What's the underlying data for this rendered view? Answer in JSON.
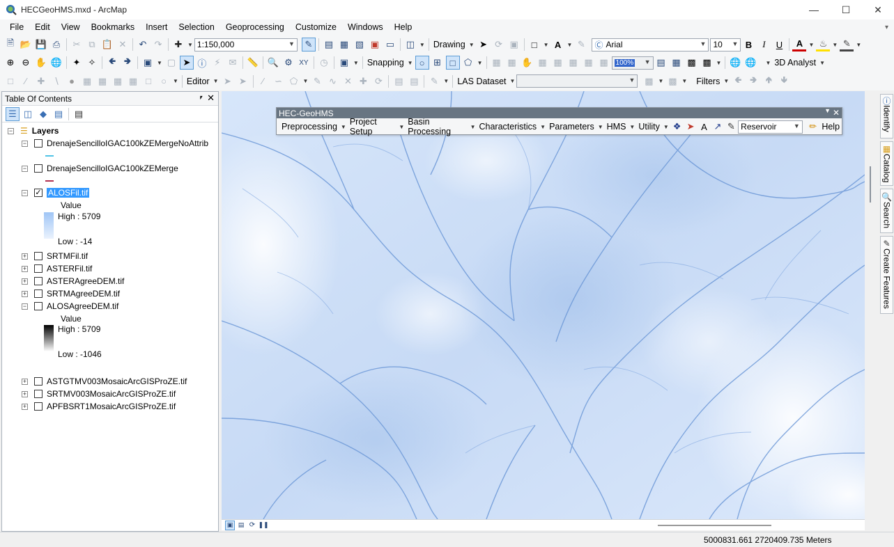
{
  "window": {
    "title": "HECGeoHMS.mxd - ArcMap",
    "min": "—",
    "max": "☐",
    "close": "✕"
  },
  "menu": [
    "File",
    "Edit",
    "View",
    "Bookmarks",
    "Insert",
    "Selection",
    "Geoprocessing",
    "Customize",
    "Windows",
    "Help"
  ],
  "toolbar": {
    "scale": "1:150,000",
    "drawing_label": "Drawing",
    "font_name": "Arial",
    "font_size": "10",
    "bold": "B",
    "italic": "I",
    "underline": "U",
    "text_a": "A",
    "snapping_label": "Snapping",
    "analyst_label": "3D Analyst",
    "editor_label": "Editor",
    "las_label": "LAS Dataset",
    "filters_label": "Filters"
  },
  "toc": {
    "title": "Table Of Contents",
    "pin": "⬍",
    "close": "✕",
    "root": "Layers",
    "layers": [
      {
        "name": "DrenajeSencilloIGAC100kZEMergeNoAttrib",
        "checked": false,
        "expanded": true,
        "symbol": "#4fc3e6"
      },
      {
        "name": "DrenajeSencilloIGAC100kZEMerge",
        "checked": false,
        "expanded": true,
        "symbol": "#b03050"
      },
      {
        "name": "ALOSFil.tif",
        "checked": true,
        "expanded": true,
        "value_label": "Value",
        "high": "High : 5709",
        "low": "Low : -14"
      },
      {
        "name": "SRTMFil.tif",
        "checked": false,
        "expanded": false
      },
      {
        "name": "ASTERFil.tif",
        "checked": false,
        "expanded": false
      },
      {
        "name": "ASTERAgreeDEM.tif",
        "checked": false,
        "expanded": false
      },
      {
        "name": "SRTMAgreeDEM.tif",
        "checked": false,
        "expanded": false
      },
      {
        "name": "ALOSAgreeDEM.tif",
        "checked": false,
        "expanded": true,
        "value_label": "Value",
        "high": "High : 5709",
        "low": "Low : -1046"
      },
      {
        "name": "ASTGTMV003MosaicArcGISProZE.tif",
        "checked": false,
        "expanded": false
      },
      {
        "name": "SRTMV003MosaicArcGISProZE.tif",
        "checked": false,
        "expanded": false
      },
      {
        "name": "APFBSRT1MosaicArcGISProZE.tif",
        "checked": false,
        "expanded": false
      }
    ]
  },
  "geohms": {
    "title": "HEC-GeoHMS",
    "menus": [
      "Preprocessing",
      "Project Setup",
      "Basin Processing",
      "Characteristics",
      "Parameters",
      "HMS",
      "Utility"
    ],
    "reservoir": "Reservoir",
    "help": "Help"
  },
  "rdock": {
    "identify": "Identify",
    "catalog": "Catalog",
    "search": "Search",
    "create_features": "Create Features"
  },
  "status": {
    "coords": "5000831.661  2720409.735 Meters"
  },
  "colors": {
    "accent": "#3399ff",
    "map_bg": "#cfe0f7",
    "river": "#6f9ad8"
  }
}
